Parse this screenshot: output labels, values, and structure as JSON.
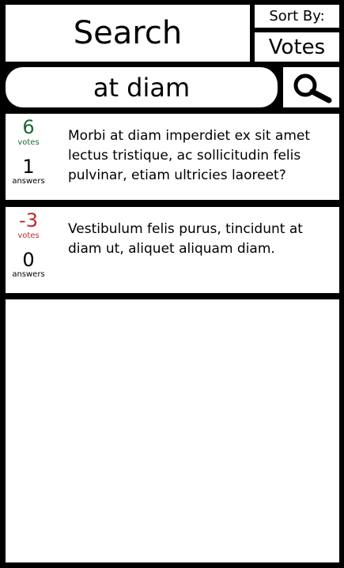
{
  "header": {
    "title": "Search",
    "sort_label": "Sort By:",
    "sort_value": "Votes"
  },
  "search": {
    "query": "at diam",
    "button_icon": "search-icon"
  },
  "results": [
    {
      "votes": "6",
      "votes_label": "votes",
      "answers": "1",
      "answers_label": "answers",
      "question": "Morbi at diam imperdiet ex sit amet lectus tristique, ac sollicitudin felis pulvinar, etiam ultricies laoreet?",
      "vote_color": "#1a6b33"
    },
    {
      "votes": "-3",
      "votes_label": "votes",
      "answers": "0",
      "answers_label": "answers",
      "question": "Vestibulum felis purus, tincidunt at diam ut, aliquet aliquam diam.",
      "vote_color": "#c0282d"
    }
  ],
  "colors": {
    "background": "#000000",
    "panel": "#ffffff",
    "positive": "#1a6b33",
    "negative": "#c0282d"
  }
}
